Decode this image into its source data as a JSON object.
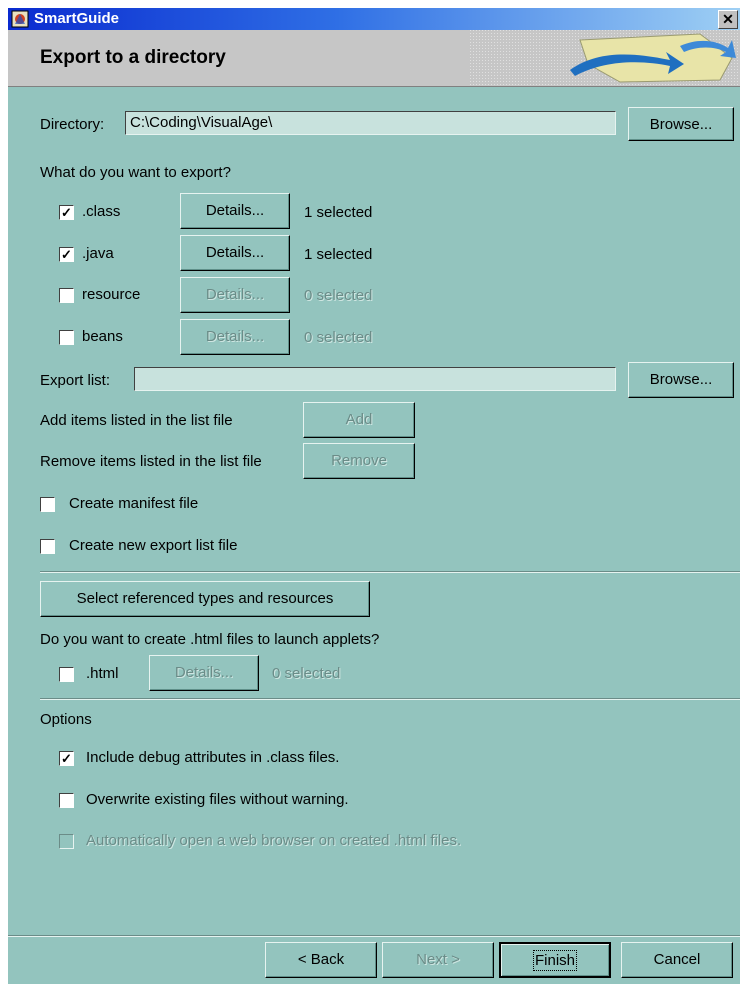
{
  "window": {
    "title": "SmartGuide",
    "close_label": "✕"
  },
  "header": {
    "title": "Export to a directory"
  },
  "directory": {
    "label": "Directory:",
    "value": "C:\\Coding\\VisualAge\\",
    "browse": "Browse..."
  },
  "export_question": "What do you want to export?",
  "export_items": [
    {
      "label": ".class",
      "checked": true,
      "details": "Details...",
      "count": "1 selected",
      "enabled": true
    },
    {
      "label": ".java",
      "checked": true,
      "details": "Details...",
      "count": "1 selected",
      "enabled": true
    },
    {
      "label": "resource",
      "checked": false,
      "details": "Details...",
      "count": "0 selected",
      "enabled": false
    },
    {
      "label": "beans",
      "checked": false,
      "details": "Details...",
      "count": "0 selected",
      "enabled": false
    }
  ],
  "export_list": {
    "label": "Export list:",
    "value": "",
    "browse": "Browse..."
  },
  "add_items": {
    "label": "Add items listed in the list file",
    "button": "Add"
  },
  "remove_items": {
    "label": "Remove items listed in the list file",
    "button": "Remove"
  },
  "create_manifest": {
    "label": "Create manifest file",
    "checked": false
  },
  "create_export_list": {
    "label": "Create new export list file",
    "checked": false
  },
  "select_referenced": "Select referenced types and resources",
  "html_question": "Do you want to create .html files to launch applets?",
  "html_item": {
    "label": ".html",
    "checked": false,
    "details": "Details...",
    "count": "0 selected"
  },
  "options": {
    "heading": "Options",
    "include_debug": {
      "label": "Include debug attributes in .class files.",
      "checked": true
    },
    "overwrite": {
      "label": "Overwrite existing files without warning.",
      "checked": false
    },
    "auto_open": {
      "label": "Automatically open a web browser on created .html files.",
      "checked": false,
      "enabled": false
    }
  },
  "footer": {
    "back": "< Back",
    "next": "Next >",
    "finish": "Finish",
    "cancel": "Cancel"
  },
  "colors": {
    "body_bg": "#93c4be",
    "header_bg": "#c6c6c6",
    "titlebar": "#0a2bd0",
    "field_bg": "#c8e2dd"
  }
}
